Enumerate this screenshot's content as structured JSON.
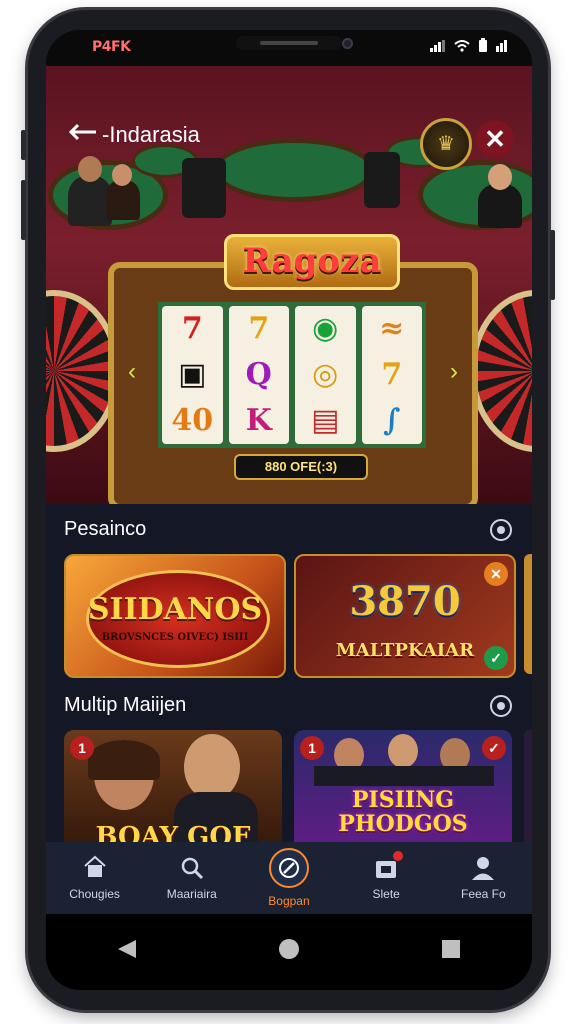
{
  "status": {
    "carrier": "P4FK"
  },
  "hero": {
    "back_label": "-Indarasia",
    "slot_title": "Ragoza",
    "credit_text": "880 OFE(:3)",
    "reels": [
      [
        "7",
        "▣",
        "40"
      ],
      [
        "7",
        "Q",
        "K"
      ],
      [
        "◉",
        "◎",
        "▤"
      ],
      [
        "≈",
        "7",
        "∫"
      ]
    ]
  },
  "section1": {
    "title": "Pesainco",
    "cards": [
      {
        "title": "SIIDANOS",
        "subtitle": "BROVSNCES OIVEC) ISIII"
      },
      {
        "title": "3870",
        "subtitle": "MALTPKAIAR"
      }
    ]
  },
  "section2": {
    "title": "Multip Maiijen",
    "cards": [
      {
        "title": "BOAY GOF"
      },
      {
        "title": "PISIING PHODGOS"
      }
    ]
  },
  "bottom_nav": [
    {
      "label": "Chougies",
      "icon": "house-icon"
    },
    {
      "label": "Maariaira",
      "icon": "search-icon"
    },
    {
      "label": "Bogpan",
      "icon": "compass-icon"
    },
    {
      "label": "Slete",
      "icon": "gift-icon"
    },
    {
      "label": "Feea Fo",
      "icon": "person-icon"
    }
  ],
  "colors": {
    "accent": "#ff8a2a",
    "nav_bg": "#1a2233",
    "hero_bg": "#7b1f2d"
  }
}
